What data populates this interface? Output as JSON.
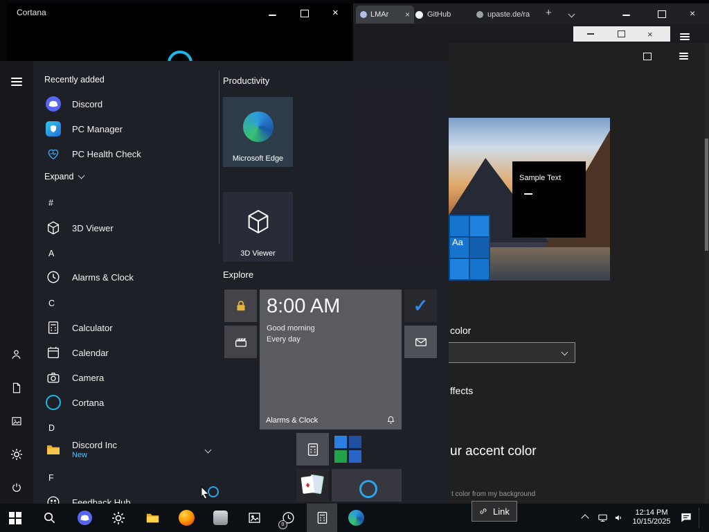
{
  "cortana": {
    "title": "Cortana"
  },
  "browser": {
    "tabs": [
      {
        "label": "LMAr"
      },
      {
        "label": "GitHub"
      },
      {
        "label": "upaste.de/ra"
      }
    ]
  },
  "icons": {
    "close": "×",
    "plus": "+",
    "check": "✓",
    "diamond": "♦"
  },
  "start": {
    "recently_added": "Recently added",
    "recent": [
      {
        "label": "Discord",
        "icon": "discord-icon"
      },
      {
        "label": "PC Manager",
        "icon": "pc-manager-icon"
      },
      {
        "label": "PC Health Check",
        "icon": "heart-pulse-icon"
      }
    ],
    "expand": "Expand",
    "sections": {
      "hash": "#",
      "a": "A",
      "c": "C",
      "d": "D",
      "f": "F"
    },
    "apps": {
      "viewer3d": "3D Viewer",
      "alarms": "Alarms & Clock",
      "calculator": "Calculator",
      "calendar": "Calendar",
      "camera": "Camera",
      "cortana": "Cortana",
      "discord_inc": "Discord Inc",
      "discord_inc_badge": "New",
      "feedback": "Feedback Hub"
    },
    "groups": {
      "productivity": "Productivity",
      "explore": "Explore"
    },
    "tiles": {
      "edge": "Microsoft Edge",
      "viewer3d": "3D Viewer",
      "alarm_time": "8:00 AM",
      "alarm_line1": "Good morning",
      "alarm_line2": "Every day",
      "alarm_footer": "Alarms & Clock"
    }
  },
  "settings": {
    "preview": {
      "sample_text": "Sample Text",
      "aa_label": "Aa"
    },
    "fragments": {
      "color_heading": "color",
      "effects_label": "ffects",
      "accent_heading": "ur accent color",
      "accent_note": "t color from my background"
    }
  },
  "link_button": {
    "label": "Link"
  },
  "taskbar": {
    "badge": "0",
    "clock_time": "12:14 PM",
    "clock_date": "10/15/2025"
  }
}
